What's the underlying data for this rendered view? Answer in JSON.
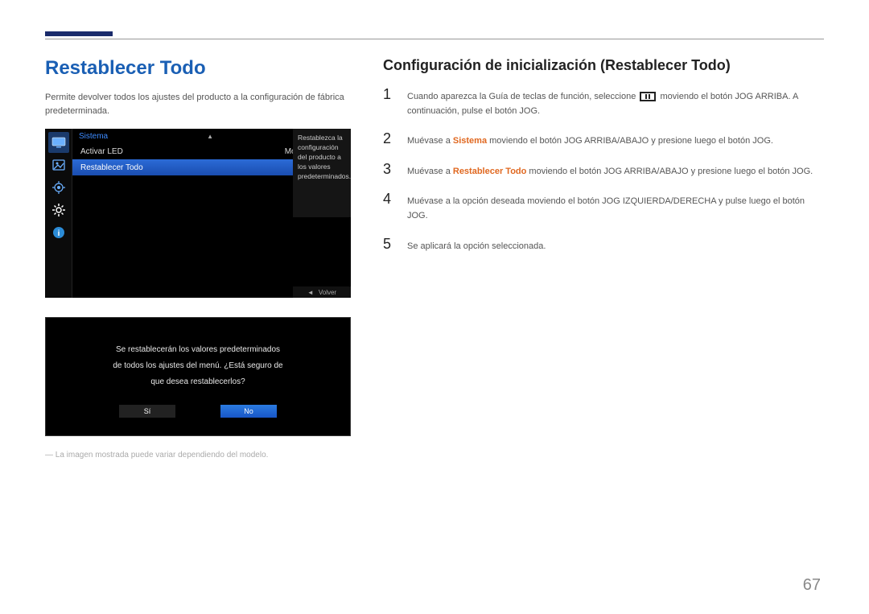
{
  "page_number": "67",
  "left": {
    "heading": "Restablecer Todo",
    "intro": "Permite devolver todos los ajustes del producto a la configuración de fábrica predeterminada.",
    "footnote": "― La imagen mostrada puede variar dependiendo del modelo."
  },
  "osd": {
    "title": "Sistema",
    "row1_label": "Activar LED",
    "row1_value": "Modo de espera",
    "row2_label": "Restablecer Todo",
    "desc": "Restablezca la configuración del producto a los valores predeterminados.",
    "back_label": "Volver"
  },
  "dialog": {
    "line1": "Se restablecerán los valores predeterminados",
    "line2": "de todos los ajustes del menú. ¿Está seguro de",
    "line3": "que desea restablecerlos?",
    "yes": "Sí",
    "no": "No"
  },
  "right": {
    "heading": "Configuración de inicialización (Restablecer Todo)",
    "steps": [
      {
        "n": "1",
        "pre": "Cuando aparezca la Guía de teclas de función, seleccione ",
        "post": " moviendo el botón JOG ARRIBA. A continuación, pulse el botón JOG."
      },
      {
        "n": "2",
        "pre": "Muévase a ",
        "kw": "Sistema",
        "post": " moviendo el botón JOG ARRIBA/ABAJO y presione luego el botón JOG."
      },
      {
        "n": "3",
        "pre": "Muévase a ",
        "kw": "Restablecer Todo",
        "post": " moviendo el botón JOG ARRIBA/ABAJO y presione luego el botón JOG."
      },
      {
        "n": "4",
        "text": "Muévase a la opción deseada moviendo el botón JOG IZQUIERDA/DERECHA y pulse luego el botón JOG."
      },
      {
        "n": "5",
        "text": "Se aplicará la opción seleccionada."
      }
    ]
  }
}
